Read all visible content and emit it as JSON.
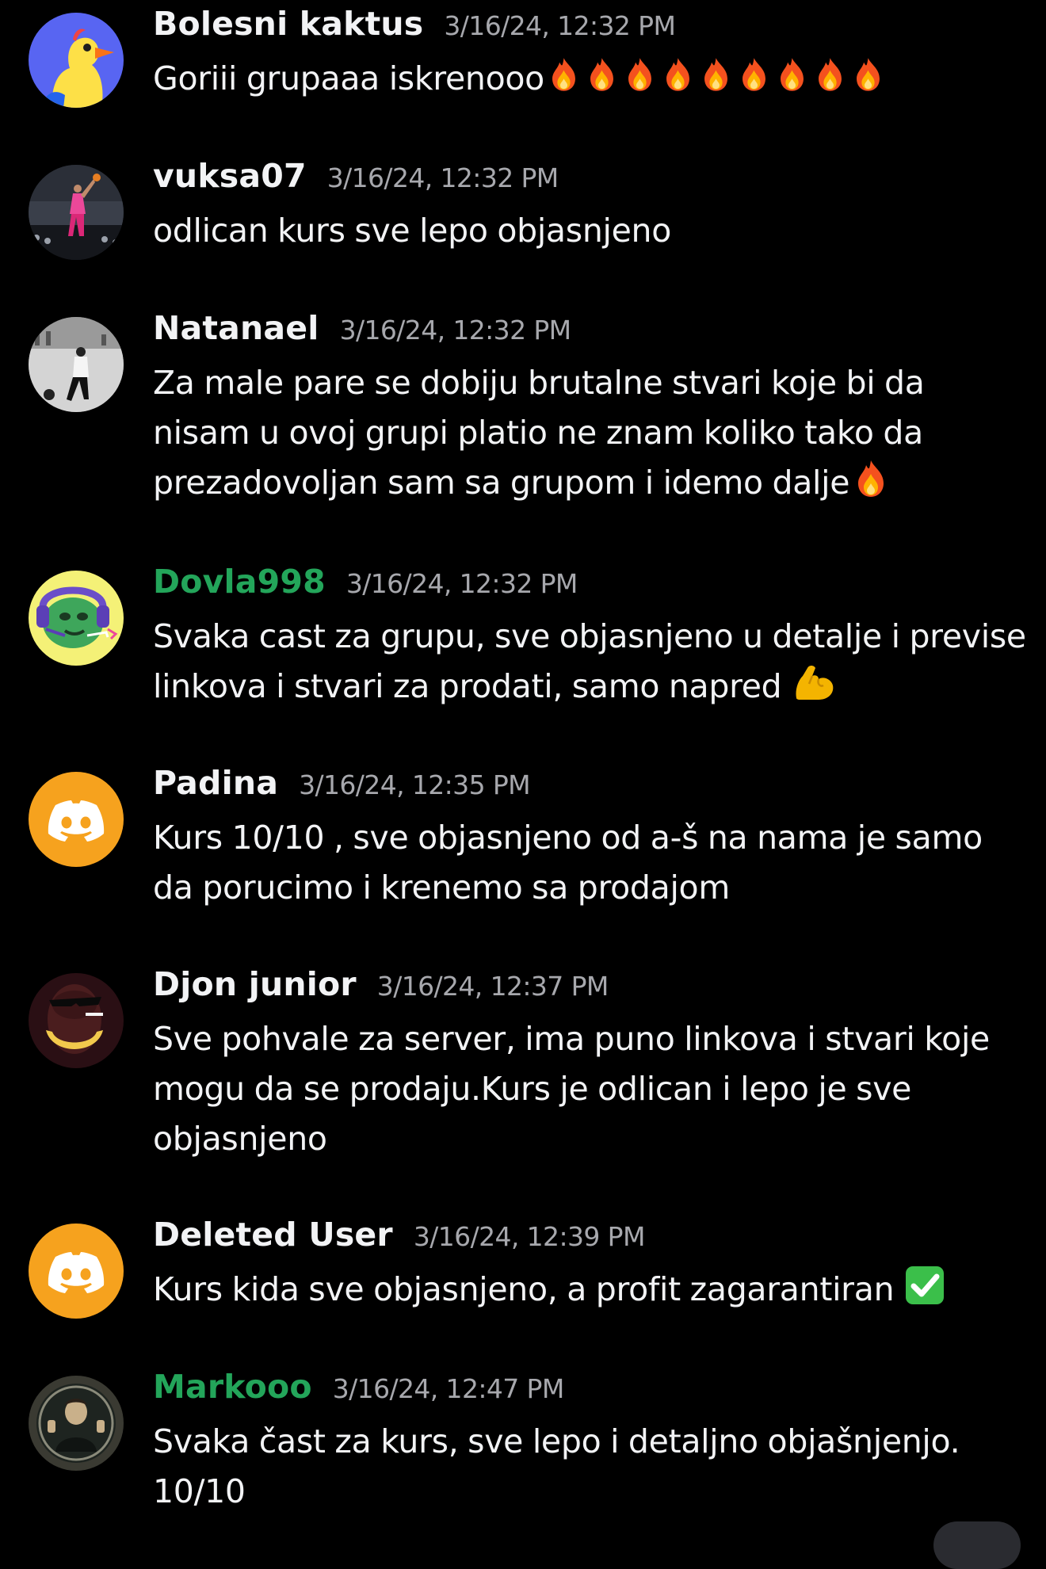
{
  "colors": {
    "background": "#000000",
    "text": "#f2f3f5",
    "timestamp": "#a7a8ad",
    "green_name": "#23a55a",
    "discord_orange": "#f6a21e"
  },
  "messages": [
    {
      "username": "Bolesni kaktus",
      "timestamp": "3/16/24, 12:32 PM",
      "avatar": "duck-avatar-icon",
      "lines": [
        "Goriii grupaaa iskrenooo"
      ],
      "emoji": [
        "fire-emoji",
        "fire-emoji",
        "fire-emoji",
        "fire-emoji",
        "fire-emoji",
        "fire-emoji",
        "fire-emoji",
        "fire-emoji",
        "fire-emoji"
      ]
    },
    {
      "username": "vuksa07",
      "timestamp": "3/16/24, 12:32 PM",
      "avatar": "basketball-photo-avatar",
      "lines": [
        "odlican kurs sve lepo objasnjeno"
      ]
    },
    {
      "username": "Natanael",
      "timestamp": "3/16/24, 12:32 PM",
      "avatar": "football-photo-avatar",
      "lines": [
        "Za male pare se dobiju brutalne stvari koje bi da",
        "nisam u ovoj grupi platio ne znam koliko tako da",
        "prezadovoljan sam sa grupom i idemo dalje"
      ],
      "emoji": [
        "fire-emoji"
      ]
    },
    {
      "username": "Dovla998",
      "timestamp": "3/16/24, 12:32 PM",
      "avatar": "green-gamer-avatar",
      "name_color": "green",
      "lines": [
        "Svaka cast za grupu, sve objasnjeno u detalje i previse",
        "linkova i stvari za prodati, samo napred "
      ],
      "emoji": [
        "flexed-biceps-emoji"
      ]
    },
    {
      "username": "Padina",
      "timestamp": "3/16/24, 12:35 PM",
      "avatar": "discord-default-avatar",
      "lines": [
        "Kurs 10/10 , sve objasnjeno od a-š na nama je samo",
        "da porucimo i krenemo sa prodajom"
      ]
    },
    {
      "username": "Djon junior",
      "timestamp": "3/16/24, 12:37 PM",
      "avatar": "sunglasses-photo-avatar",
      "lines": [
        "Sve pohvale za server, ima puno linkova i stvari koje",
        "mogu da se prodaju.Kurs je odlican i lepo je sve",
        "objasnjeno"
      ]
    },
    {
      "username": "Deleted User",
      "timestamp": "3/16/24, 12:39 PM",
      "avatar": "discord-default-avatar",
      "lines": [
        "Kurs kida sve objasnjeno, a profit zagarantiran "
      ],
      "emoji": [
        "check-mark-emoji"
      ]
    },
    {
      "username": "Markooo",
      "timestamp": "3/16/24, 12:47 PM",
      "avatar": "portrait-photo-avatar",
      "name_color": "green",
      "lines": [
        "Svaka čast za kurs, sve lepo i detaljno objašnjenjo.",
        "10/10"
      ]
    }
  ]
}
